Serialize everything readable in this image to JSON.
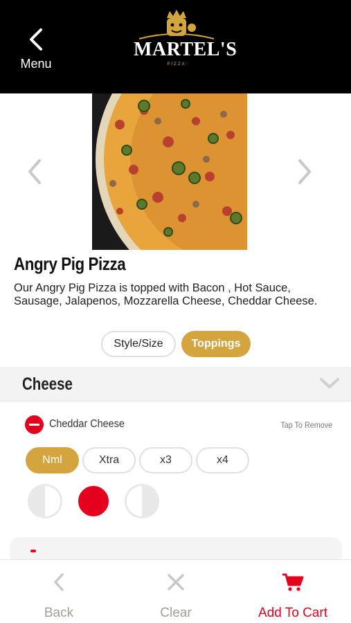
{
  "header": {
    "back_label": "Menu",
    "logo_text": "MARTEL'S",
    "logo_sub": "PIZZA"
  },
  "product": {
    "name": "Angry Pig Pizza",
    "description": "Our Angry Pig Pizza is topped with Bacon , Hot Sauce, Sausage, Jalapenos, Mozzarella Cheese, Cheddar Cheese."
  },
  "tabs": {
    "style_label": "Style/Size",
    "toppings_label": "Toppings",
    "active": "Toppings"
  },
  "section": {
    "title": "Cheese"
  },
  "topping": {
    "name": "Cheddar Cheese",
    "tap_hint": "Tap To Remove",
    "amounts": [
      "Nml",
      "Xtra",
      "x3",
      "x4"
    ],
    "selected_amount": "Nml",
    "selected_portion": "whole"
  },
  "bottom_nav": {
    "back": "Back",
    "clear": "Clear",
    "add_to_cart": "Add To Cart"
  },
  "colors": {
    "header_bg": "#000000",
    "gold": "#d4a53f",
    "red": "#e5001e"
  }
}
